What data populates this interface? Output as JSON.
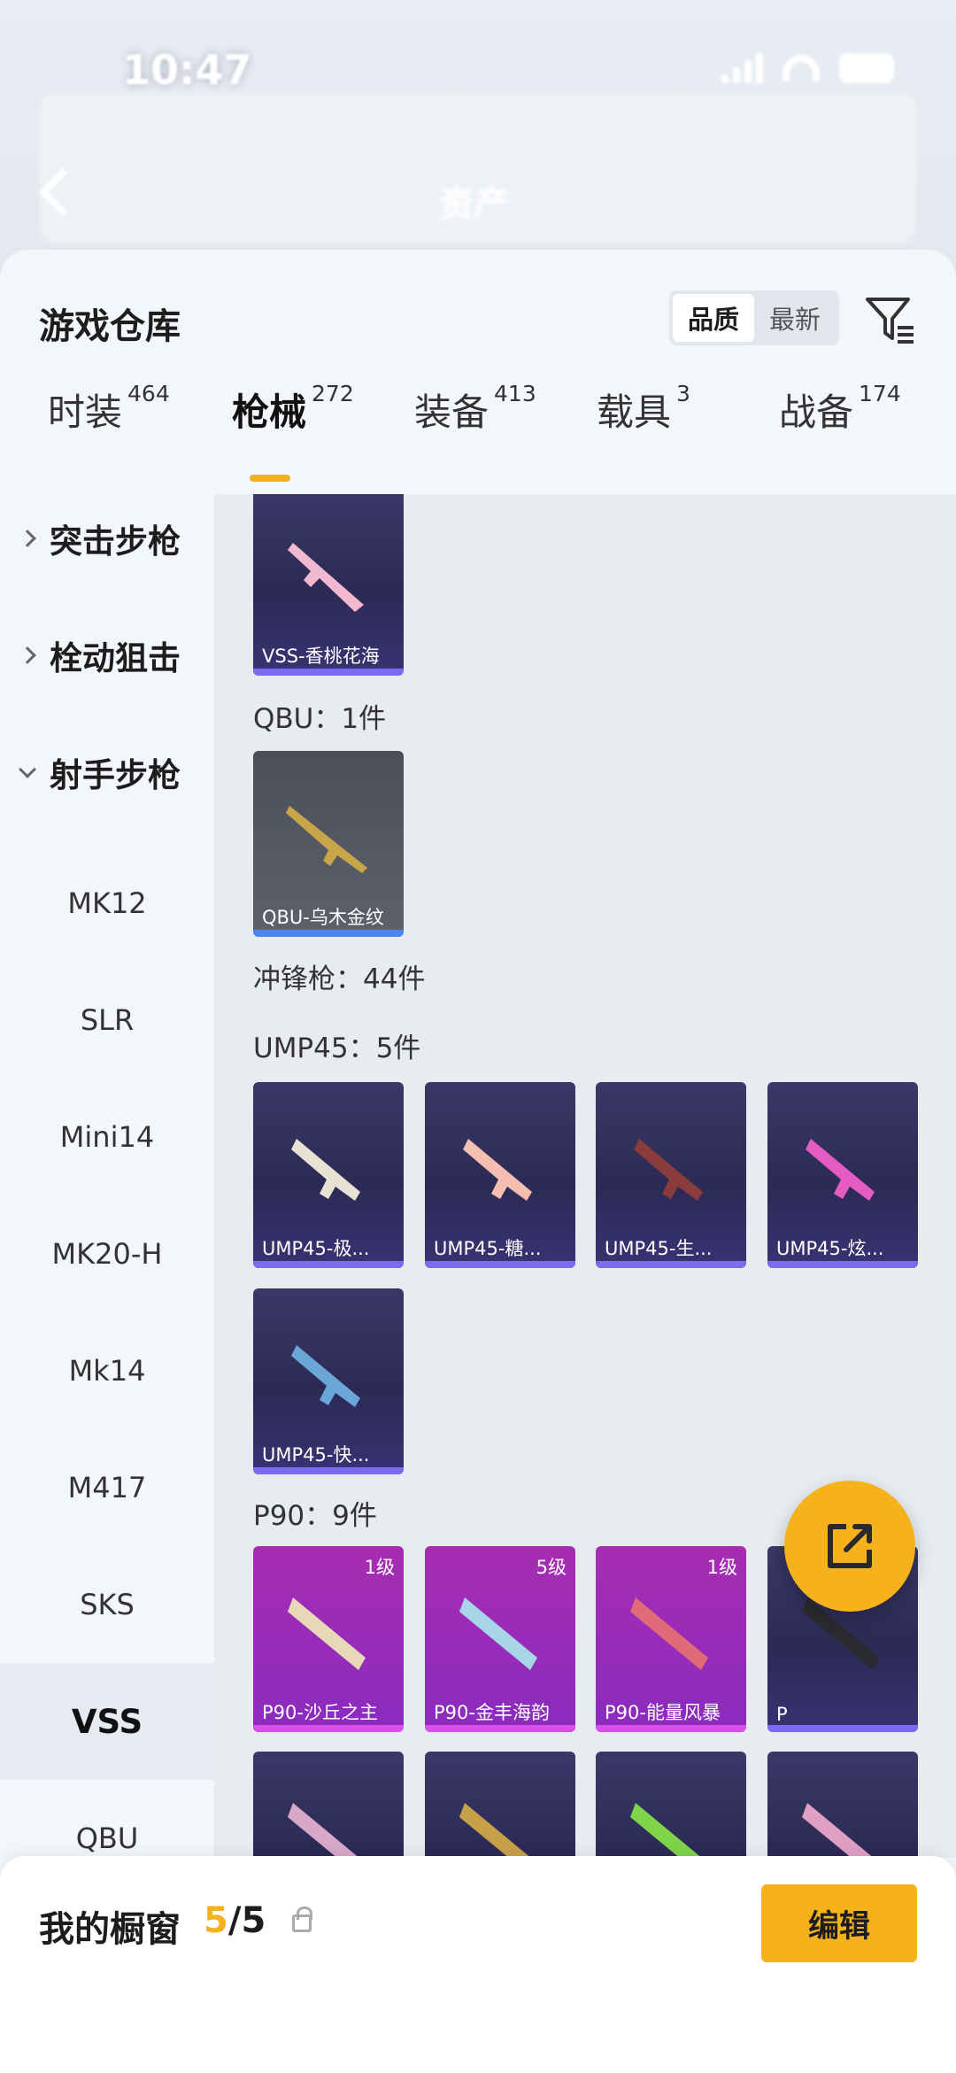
{
  "status_bar": {
    "time": "10:47"
  },
  "header": {
    "title": "资产"
  },
  "sheet": {
    "title": "游戏仓库",
    "sort": {
      "options": [
        "品质",
        "最新"
      ],
      "active": 0
    }
  },
  "tabs": [
    {
      "label": "时装",
      "count": "464"
    },
    {
      "label": "枪械",
      "count": "272",
      "active": true
    },
    {
      "label": "装备",
      "count": "413"
    },
    {
      "label": "载具",
      "count": "3"
    },
    {
      "label": "战备",
      "count": "174"
    }
  ],
  "sidebar": {
    "groups": [
      {
        "label": "突击步枪",
        "expanded": false
      },
      {
        "label": "栓动狙击",
        "expanded": false
      },
      {
        "label": "射手步枪",
        "expanded": true
      }
    ],
    "items": [
      "MK12",
      "SLR",
      "Mini14",
      "MK20-H",
      "Mk14",
      "M417",
      "SKS",
      "VSS",
      "QBU"
    ],
    "active_item": "VSS"
  },
  "content": {
    "vss_card": {
      "name": "VSS-香桃花海"
    },
    "qbu_header": "QBU：1件",
    "qbu_card": {
      "name": "QBU-乌木金纹"
    },
    "smg_header": "冲锋枪：44件",
    "ump_header": "UMP45：5件",
    "ump_cards": [
      {
        "name": "UMP45-极..."
      },
      {
        "name": "UMP45-糖..."
      },
      {
        "name": "UMP45-生..."
      },
      {
        "name": "UMP45-炫..."
      },
      {
        "name": "UMP45-快..."
      }
    ],
    "p90_header": "P90：9件",
    "p90_cards": [
      {
        "name": "P90-沙丘之主",
        "level": "1级"
      },
      {
        "name": "P90-金丰海韵",
        "level": "5级"
      },
      {
        "name": "P90-能量风暴",
        "level": "1级"
      },
      {
        "name": "P",
        "level": ""
      }
    ]
  },
  "bottom_bar": {
    "label": "我的橱窗",
    "count_current": "5",
    "count_total": "/5",
    "edit_label": "编辑"
  },
  "colors": {
    "accent": "#f5b21b"
  }
}
